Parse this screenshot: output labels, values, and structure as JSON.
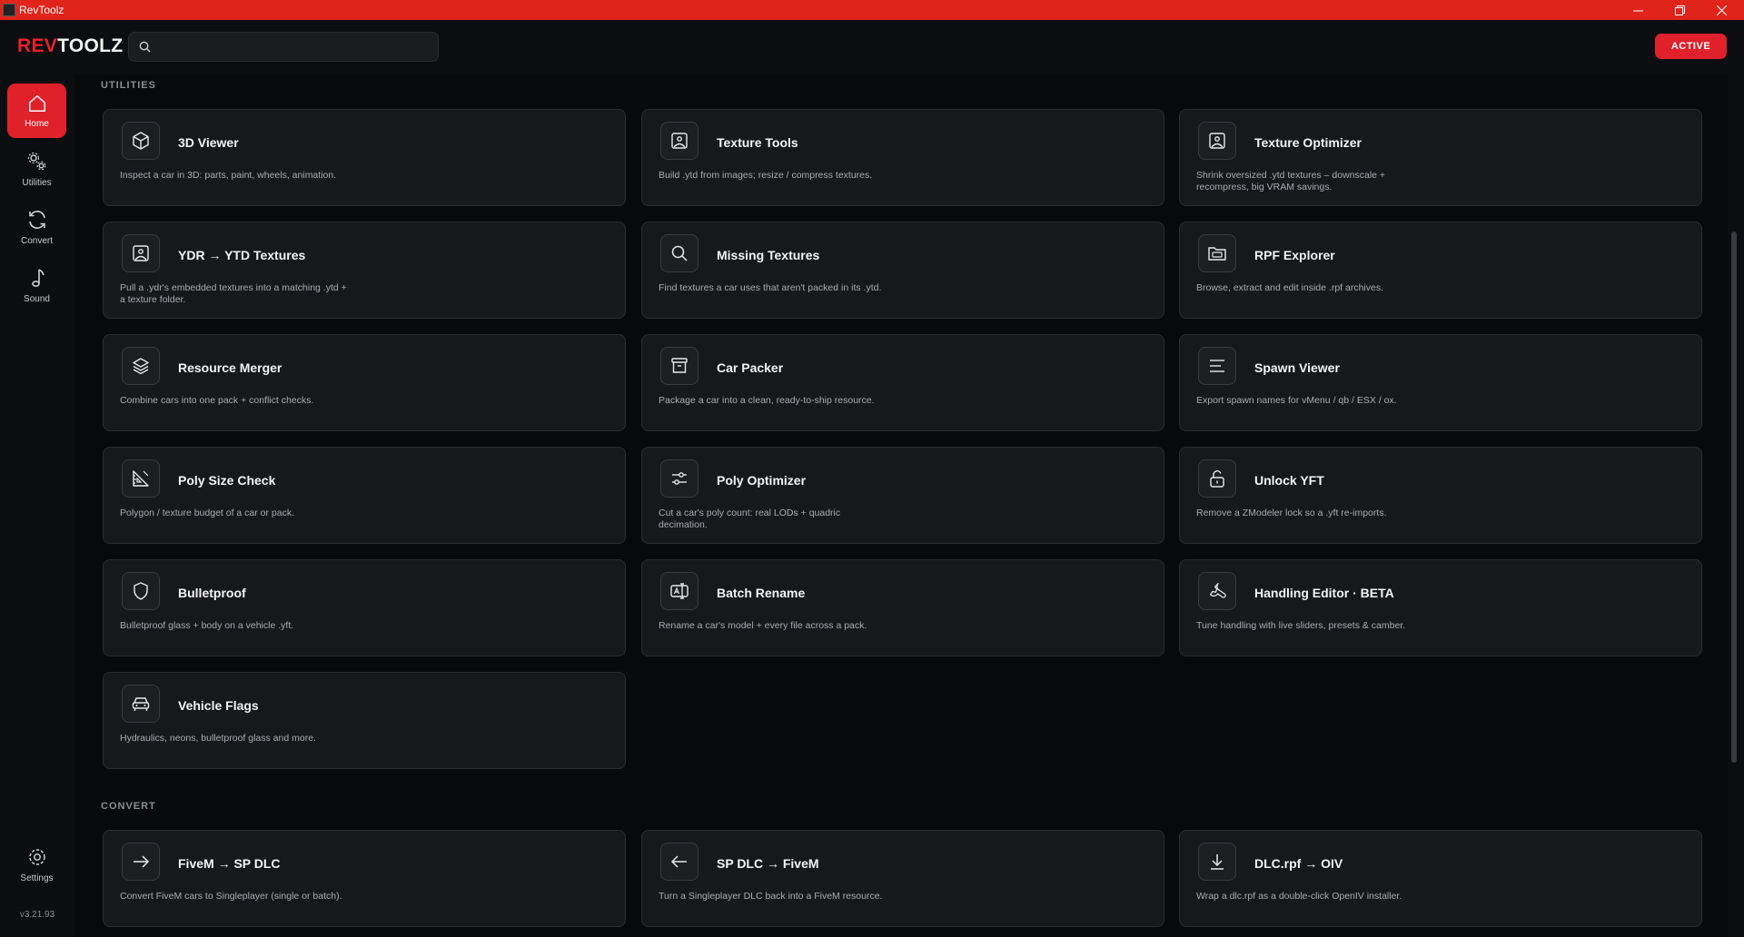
{
  "window": {
    "title": "RevToolz"
  },
  "header": {
    "logo_rev": "REV",
    "logo_toolz": "TOOLZ",
    "search_placeholder": "",
    "status_button": "ACTIVE"
  },
  "sidebar": {
    "items": [
      {
        "label": "Home",
        "icon": "home-icon"
      },
      {
        "label": "Utilities",
        "icon": "gears-icon"
      },
      {
        "label": "Convert",
        "icon": "refresh-icon"
      },
      {
        "label": "Sound",
        "icon": "music-note-icon"
      }
    ],
    "settings_label": "Settings",
    "version": "v3.21.93"
  },
  "sections": {
    "utilities": "UTILITIES",
    "convert": "CONVERT"
  },
  "cards": [
    {
      "title": "3D Viewer",
      "desc": "Inspect a car in 3D: parts, paint, wheels, animation.",
      "icon": "cube-icon"
    },
    {
      "title": "Texture Tools",
      "desc": "Build .ytd from images; resize / compress textures.",
      "icon": "image-icon"
    },
    {
      "title": "Texture Optimizer",
      "desc": "Shrink oversized .ytd textures – downscale + recompress, big VRAM savings.",
      "icon": "image-icon"
    },
    {
      "title": "YDR → YTD Textures",
      "desc": "Pull a .ydr's embedded textures into a matching .ytd + a texture folder.",
      "icon": "image-icon"
    },
    {
      "title": "Missing Textures",
      "desc": "Find textures a car uses that aren't packed in its .ytd.",
      "icon": "search-icon"
    },
    {
      "title": "RPF Explorer",
      "desc": "Browse, extract and edit inside .rpf archives.",
      "icon": "folder-icon"
    },
    {
      "title": "Resource Merger",
      "desc": "Combine cars into one pack + conflict checks.",
      "icon": "layers-icon"
    },
    {
      "title": "Car Packer",
      "desc": "Package a car into a clean, ready-to-ship resource.",
      "icon": "archive-icon"
    },
    {
      "title": "Spawn Viewer",
      "desc": "Export spawn names for vMenu / qb / ESX / ox.",
      "icon": "lines-icon"
    },
    {
      "title": "Poly Size Check",
      "desc": "Polygon / texture budget of a car or pack.",
      "icon": "ruler-icon"
    },
    {
      "title": "Poly Optimizer",
      "desc": "Cut a car's poly count: real LODs + quadric decimation.",
      "icon": "sliders-icon"
    },
    {
      "title": "Unlock YFT",
      "desc": "Remove a ZModeler lock so a .yft re-imports.",
      "icon": "unlock-icon"
    },
    {
      "title": "Bulletproof",
      "desc": "Bulletproof glass + body on a vehicle .yft.",
      "icon": "shield-icon"
    },
    {
      "title": "Batch Rename",
      "desc": "Rename a car's model + every file across a pack.",
      "icon": "rename-icon"
    },
    {
      "title": "Handling Editor  · BETA",
      "desc": "Tune handling with live sliders, presets & camber.",
      "icon": "wrench-icon"
    },
    {
      "title": "Vehicle Flags",
      "desc": "Hydraulics, neons, bulletproof glass and more.",
      "icon": "car-icon"
    }
  ],
  "convert_cards": [
    {
      "title": "FiveM → SP DLC",
      "desc": "Convert FiveM cars to Singleplayer (single or batch).",
      "icon": "arrow-right-icon"
    },
    {
      "title": "SP DLC → FiveM",
      "desc": "Turn a Singleplayer DLC back into a FiveM resource.",
      "icon": "arrow-left-icon"
    },
    {
      "title": "DLC.rpf → OIV",
      "desc": "Wrap a dlc.rpf as a double-click OpenIV installer.",
      "icon": "download-icon"
    }
  ],
  "colors": {
    "accent": "#e0202a",
    "titlebar": "#e0241b",
    "card_bg": "#17181c",
    "app_bg": "#08090b"
  }
}
